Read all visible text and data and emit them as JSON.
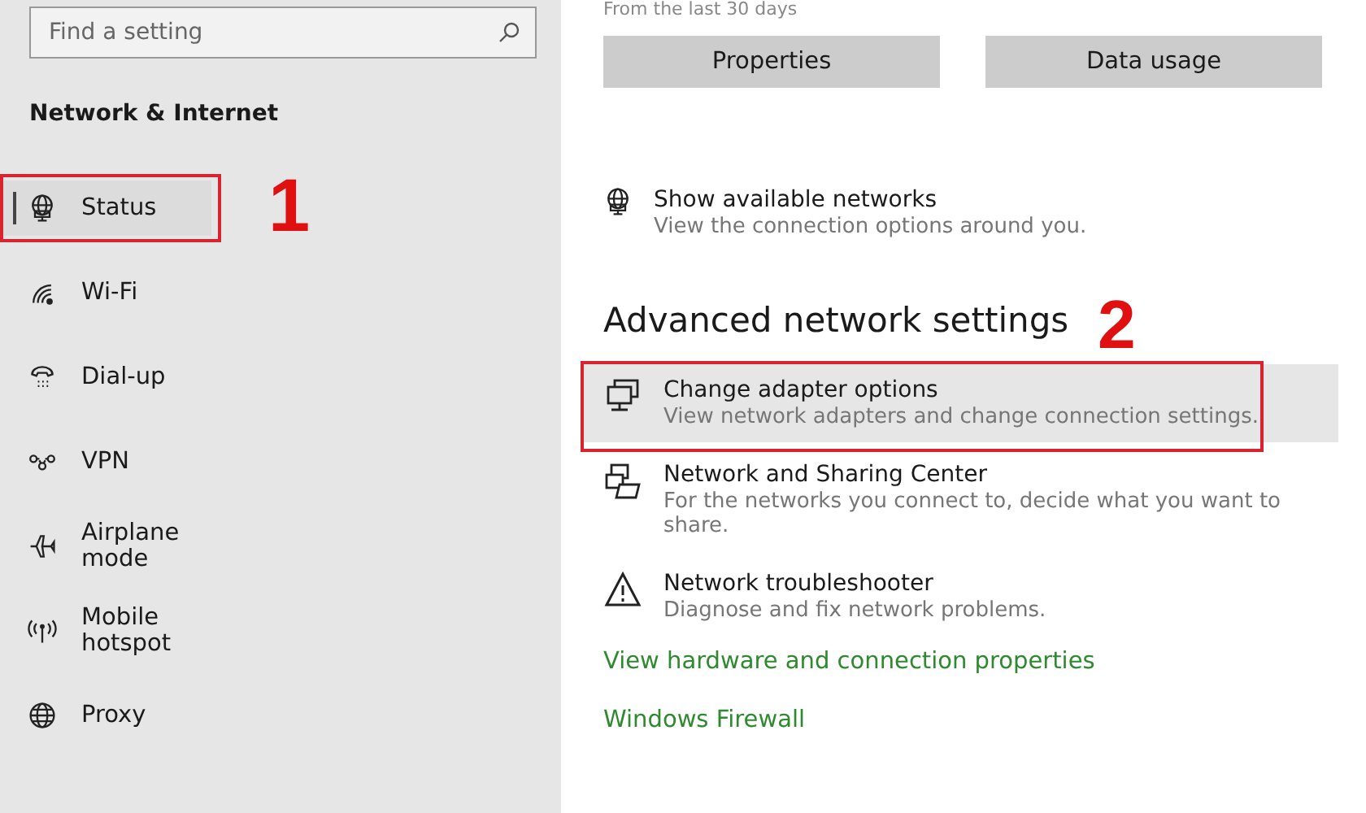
{
  "sidebar": {
    "search": {
      "placeholder": "Find a setting"
    },
    "heading": "Network & Internet",
    "items": [
      {
        "label": "Status",
        "kind": "status",
        "selected": true,
        "highlighted": true,
        "annotation": "1"
      },
      {
        "label": "Wi-Fi",
        "kind": "wifi",
        "selected": false,
        "highlighted": false
      },
      {
        "label": "Dial-up",
        "kind": "dialup",
        "selected": false,
        "highlighted": false
      },
      {
        "label": "VPN",
        "kind": "vpn",
        "selected": false,
        "highlighted": false
      },
      {
        "label": "Airplane mode",
        "kind": "airplane",
        "selected": false,
        "highlighted": false
      },
      {
        "label": "Mobile hotspot",
        "kind": "hotspot",
        "selected": false,
        "highlighted": false
      },
      {
        "label": "Proxy",
        "kind": "globe",
        "selected": false,
        "highlighted": false
      }
    ]
  },
  "main": {
    "usage_note": "From the last 30 days",
    "buttons": [
      "Properties",
      "Data usage"
    ],
    "top_options": [
      {
        "kind": "status",
        "title": "Show available networks",
        "description": "View the connection options around you.",
        "hovered": false,
        "highlighted": false
      }
    ],
    "section_heading": "Advanced network settings",
    "options": [
      {
        "kind": "adapter",
        "title": "Change adapter options",
        "description": "View network adapters and change connection settings.",
        "hovered": true,
        "highlighted": true,
        "annotation": "2"
      },
      {
        "kind": "sharing",
        "title": "Network and Sharing Center",
        "description": "For the networks you connect to, decide what you want to share.",
        "hovered": false,
        "highlighted": false
      },
      {
        "kind": "warning",
        "title": "Network troubleshooter",
        "description": "Diagnose and fix network problems.",
        "hovered": false,
        "highlighted": false
      }
    ],
    "links": [
      "View hardware and connection properties",
      "Windows Firewall"
    ]
  }
}
